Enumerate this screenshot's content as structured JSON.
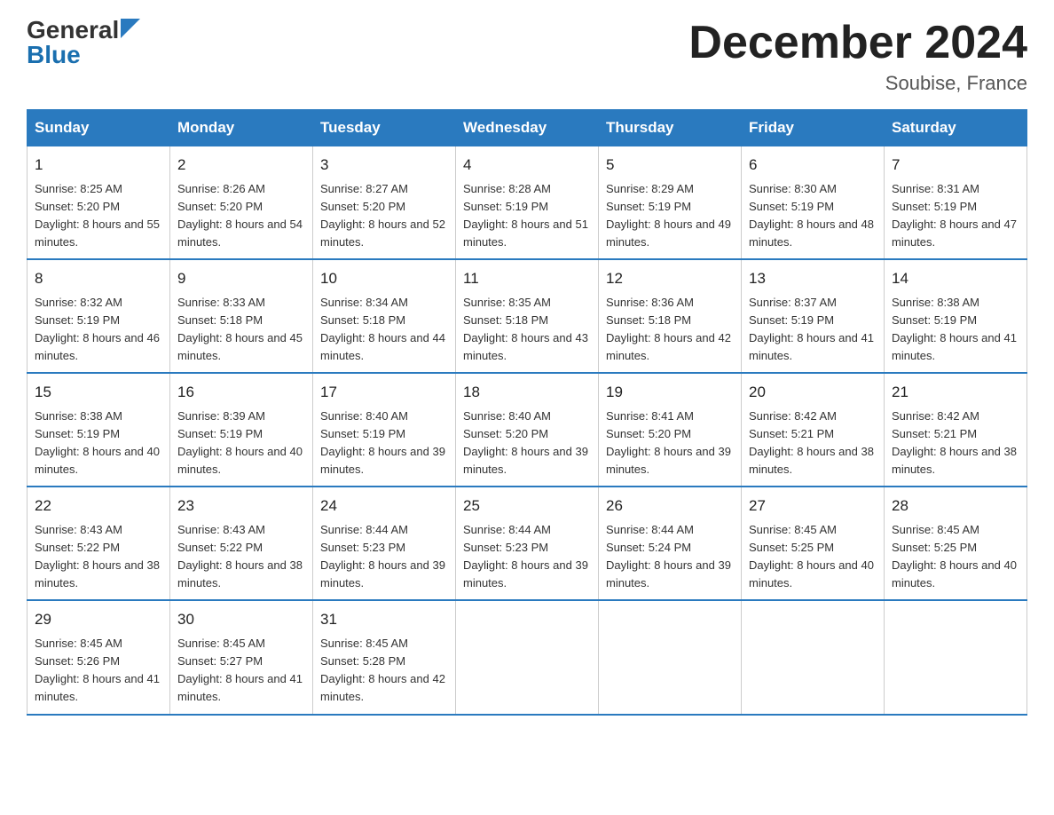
{
  "logo": {
    "general": "General",
    "blue": "Blue"
  },
  "title": "December 2024",
  "location": "Soubise, France",
  "days_of_week": [
    "Sunday",
    "Monday",
    "Tuesday",
    "Wednesday",
    "Thursday",
    "Friday",
    "Saturday"
  ],
  "weeks": [
    [
      {
        "day": "1",
        "sunrise": "8:25 AM",
        "sunset": "5:20 PM",
        "daylight": "8 hours and 55 minutes."
      },
      {
        "day": "2",
        "sunrise": "8:26 AM",
        "sunset": "5:20 PM",
        "daylight": "8 hours and 54 minutes."
      },
      {
        "day": "3",
        "sunrise": "8:27 AM",
        "sunset": "5:20 PM",
        "daylight": "8 hours and 52 minutes."
      },
      {
        "day": "4",
        "sunrise": "8:28 AM",
        "sunset": "5:19 PM",
        "daylight": "8 hours and 51 minutes."
      },
      {
        "day": "5",
        "sunrise": "8:29 AM",
        "sunset": "5:19 PM",
        "daylight": "8 hours and 49 minutes."
      },
      {
        "day": "6",
        "sunrise": "8:30 AM",
        "sunset": "5:19 PM",
        "daylight": "8 hours and 48 minutes."
      },
      {
        "day": "7",
        "sunrise": "8:31 AM",
        "sunset": "5:19 PM",
        "daylight": "8 hours and 47 minutes."
      }
    ],
    [
      {
        "day": "8",
        "sunrise": "8:32 AM",
        "sunset": "5:19 PM",
        "daylight": "8 hours and 46 minutes."
      },
      {
        "day": "9",
        "sunrise": "8:33 AM",
        "sunset": "5:18 PM",
        "daylight": "8 hours and 45 minutes."
      },
      {
        "day": "10",
        "sunrise": "8:34 AM",
        "sunset": "5:18 PM",
        "daylight": "8 hours and 44 minutes."
      },
      {
        "day": "11",
        "sunrise": "8:35 AM",
        "sunset": "5:18 PM",
        "daylight": "8 hours and 43 minutes."
      },
      {
        "day": "12",
        "sunrise": "8:36 AM",
        "sunset": "5:18 PM",
        "daylight": "8 hours and 42 minutes."
      },
      {
        "day": "13",
        "sunrise": "8:37 AM",
        "sunset": "5:19 PM",
        "daylight": "8 hours and 41 minutes."
      },
      {
        "day": "14",
        "sunrise": "8:38 AM",
        "sunset": "5:19 PM",
        "daylight": "8 hours and 41 minutes."
      }
    ],
    [
      {
        "day": "15",
        "sunrise": "8:38 AM",
        "sunset": "5:19 PM",
        "daylight": "8 hours and 40 minutes."
      },
      {
        "day": "16",
        "sunrise": "8:39 AM",
        "sunset": "5:19 PM",
        "daylight": "8 hours and 40 minutes."
      },
      {
        "day": "17",
        "sunrise": "8:40 AM",
        "sunset": "5:19 PM",
        "daylight": "8 hours and 39 minutes."
      },
      {
        "day": "18",
        "sunrise": "8:40 AM",
        "sunset": "5:20 PM",
        "daylight": "8 hours and 39 minutes."
      },
      {
        "day": "19",
        "sunrise": "8:41 AM",
        "sunset": "5:20 PM",
        "daylight": "8 hours and 39 minutes."
      },
      {
        "day": "20",
        "sunrise": "8:42 AM",
        "sunset": "5:21 PM",
        "daylight": "8 hours and 38 minutes."
      },
      {
        "day": "21",
        "sunrise": "8:42 AM",
        "sunset": "5:21 PM",
        "daylight": "8 hours and 38 minutes."
      }
    ],
    [
      {
        "day": "22",
        "sunrise": "8:43 AM",
        "sunset": "5:22 PM",
        "daylight": "8 hours and 38 minutes."
      },
      {
        "day": "23",
        "sunrise": "8:43 AM",
        "sunset": "5:22 PM",
        "daylight": "8 hours and 38 minutes."
      },
      {
        "day": "24",
        "sunrise": "8:44 AM",
        "sunset": "5:23 PM",
        "daylight": "8 hours and 39 minutes."
      },
      {
        "day": "25",
        "sunrise": "8:44 AM",
        "sunset": "5:23 PM",
        "daylight": "8 hours and 39 minutes."
      },
      {
        "day": "26",
        "sunrise": "8:44 AM",
        "sunset": "5:24 PM",
        "daylight": "8 hours and 39 minutes."
      },
      {
        "day": "27",
        "sunrise": "8:45 AM",
        "sunset": "5:25 PM",
        "daylight": "8 hours and 40 minutes."
      },
      {
        "day": "28",
        "sunrise": "8:45 AM",
        "sunset": "5:25 PM",
        "daylight": "8 hours and 40 minutes."
      }
    ],
    [
      {
        "day": "29",
        "sunrise": "8:45 AM",
        "sunset": "5:26 PM",
        "daylight": "8 hours and 41 minutes."
      },
      {
        "day": "30",
        "sunrise": "8:45 AM",
        "sunset": "5:27 PM",
        "daylight": "8 hours and 41 minutes."
      },
      {
        "day": "31",
        "sunrise": "8:45 AM",
        "sunset": "5:28 PM",
        "daylight": "8 hours and 42 minutes."
      },
      null,
      null,
      null,
      null
    ]
  ]
}
